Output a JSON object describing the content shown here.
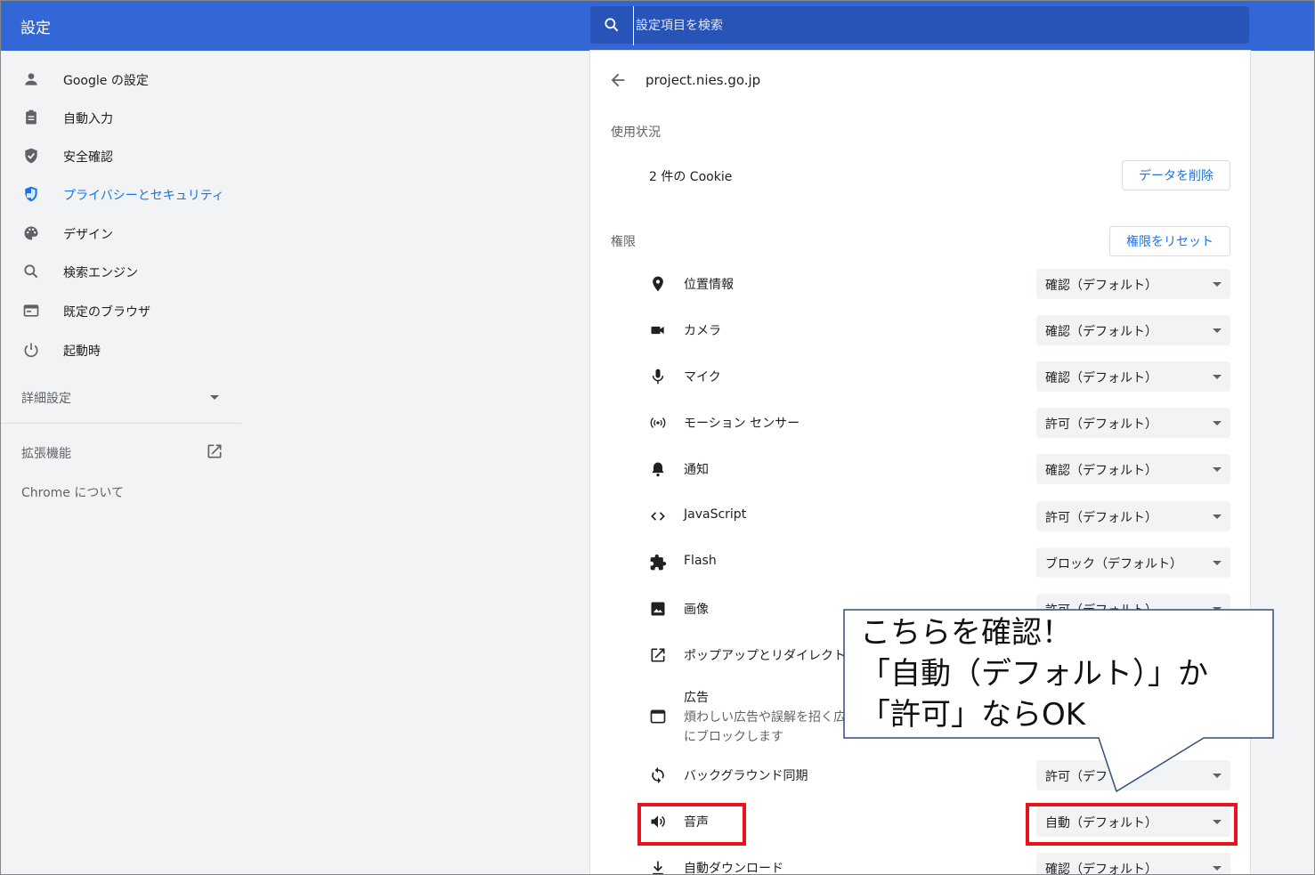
{
  "app": {
    "title": "設定"
  },
  "search": {
    "placeholder": "設定項目を検索"
  },
  "sidebar": {
    "items": [
      {
        "label": "Google の設定",
        "icon": "person-icon"
      },
      {
        "label": "自動入力",
        "icon": "clipboard-icon"
      },
      {
        "label": "安全確認",
        "icon": "shield-check-icon"
      },
      {
        "label": "プライバシーとセキュリティ",
        "icon": "shield-icon",
        "active": true
      },
      {
        "label": "デザイン",
        "icon": "palette-icon"
      },
      {
        "label": "検索エンジン",
        "icon": "search-icon"
      },
      {
        "label": "既定のブラウザ",
        "icon": "browser-icon"
      },
      {
        "label": "起動時",
        "icon": "power-icon"
      }
    ],
    "advanced": "詳細設定",
    "extensions": "拡張機能",
    "about": "Chrome について"
  },
  "main": {
    "site": "project.nies.go.jp",
    "usage_label": "使用状況",
    "cookies": "2 件の Cookie",
    "delete_button": "データを削除",
    "permissions_label": "権限",
    "reset_button": "権限をリセット",
    "permissions": [
      {
        "label": "位置情報",
        "value": "確認（デフォルト）",
        "icon": "location-pin-icon"
      },
      {
        "label": "カメラ",
        "value": "確認（デフォルト）",
        "icon": "camera-icon"
      },
      {
        "label": "マイク",
        "value": "確認（デフォルト）",
        "icon": "microphone-icon"
      },
      {
        "label": "モーション センサー",
        "value": "許可（デフォルト）",
        "icon": "sensor-icon"
      },
      {
        "label": "通知",
        "value": "確認（デフォルト）",
        "icon": "bell-icon"
      },
      {
        "label": "JavaScript",
        "value": "許可（デフォルト）",
        "icon": "code-icon"
      },
      {
        "label": "Flash",
        "value": "ブロック（デフォルト）",
        "icon": "puzzle-icon"
      },
      {
        "label": "画像",
        "value": "許可（デフォルト）",
        "icon": "image-icon"
      },
      {
        "label": "ポップアップとリダイレクト",
        "value": "",
        "icon": "open-in-new-icon"
      },
      {
        "label": "広告",
        "sub1": "煩わしい広告や誤解を招く広",
        "sub2": "にブロックします",
        "value": "",
        "icon": "ad-icon"
      },
      {
        "label": "バックグラウンド同期",
        "value": "許可（デフ",
        "icon": "sync-icon"
      },
      {
        "label": "音声",
        "value": "自動（デフォルト）",
        "icon": "speaker-icon"
      },
      {
        "label": "自動ダウンロード",
        "value": "確認（デフォルト）",
        "icon": "download-icon"
      }
    ]
  },
  "annotation": {
    "line1": "こちらを確認！",
    "line2": "「自動（デフォルト）」か",
    "line3": "「許可」ならOK",
    "highlight_color": "#e8141b"
  },
  "colors": {
    "header": "#3367d6",
    "accent": "#1a73e8"
  }
}
